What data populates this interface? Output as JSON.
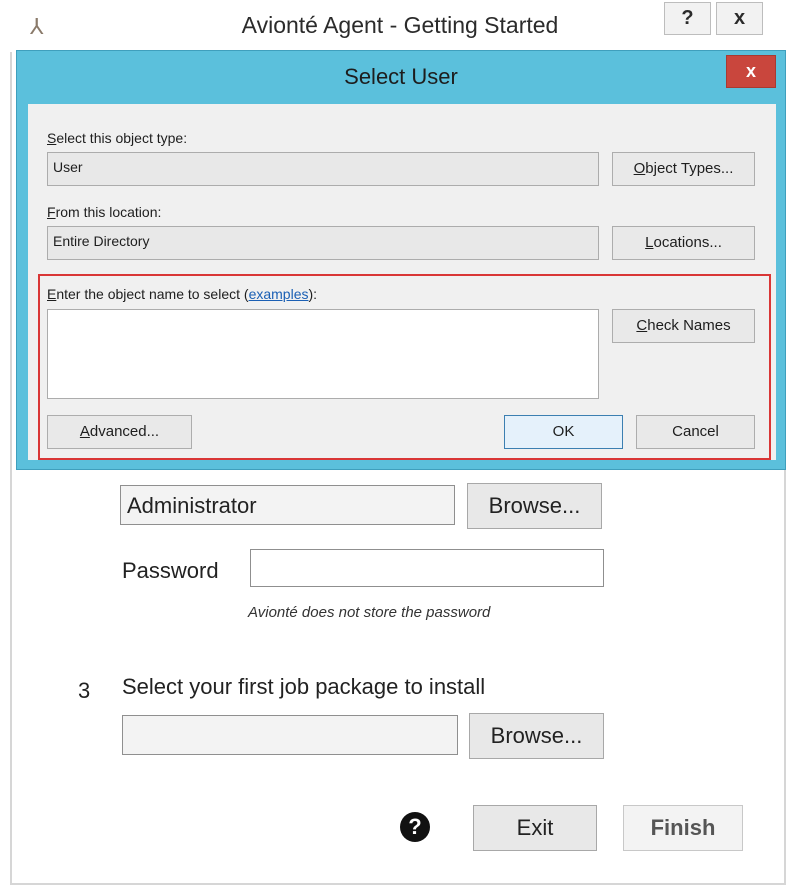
{
  "outer": {
    "title": "Avionté Agent - Getting Started",
    "logo_icon": "avionte-logo-icon",
    "help_btn": "?",
    "close_btn": "x",
    "username_value": "Administrator",
    "browse_user_label": "Browse...",
    "password_label": "Password",
    "password_value": "",
    "password_note": "Avionté does not store the password",
    "step3_number": "3",
    "step3_title": "Select your first job package to install",
    "package_value": "",
    "browse_package_label": "Browse...",
    "exit_label": "Exit",
    "finish_label": "Finish",
    "help_icon_glyph": "?"
  },
  "select_user": {
    "title": "Select User",
    "close_glyph": "x",
    "object_type_label_pre": "S",
    "object_type_label_rest": "elect this object type:",
    "object_type_value": "User",
    "object_types_btn_pre": "O",
    "object_types_btn_rest": "bject Types...",
    "location_label_pre": "F",
    "location_label_rest": "rom this location:",
    "location_value": "Entire Directory",
    "locations_btn_pre": "L",
    "locations_btn_rest": "ocations...",
    "enter_label_pre": "E",
    "enter_label_mid": "nter the object name to select (",
    "examples_link": "examples",
    "enter_label_end": "):",
    "object_name_value": "",
    "check_names_pre": "C",
    "check_names_rest": "heck Names",
    "advanced_pre": "A",
    "advanced_rest": "dvanced...",
    "ok_label": "OK",
    "cancel_label": "Cancel"
  },
  "colors": {
    "dialog_frame": "#5bc0dc",
    "close_red": "#c9463d",
    "highlight_red": "#d93636",
    "link_blue": "#1a5fb4"
  }
}
